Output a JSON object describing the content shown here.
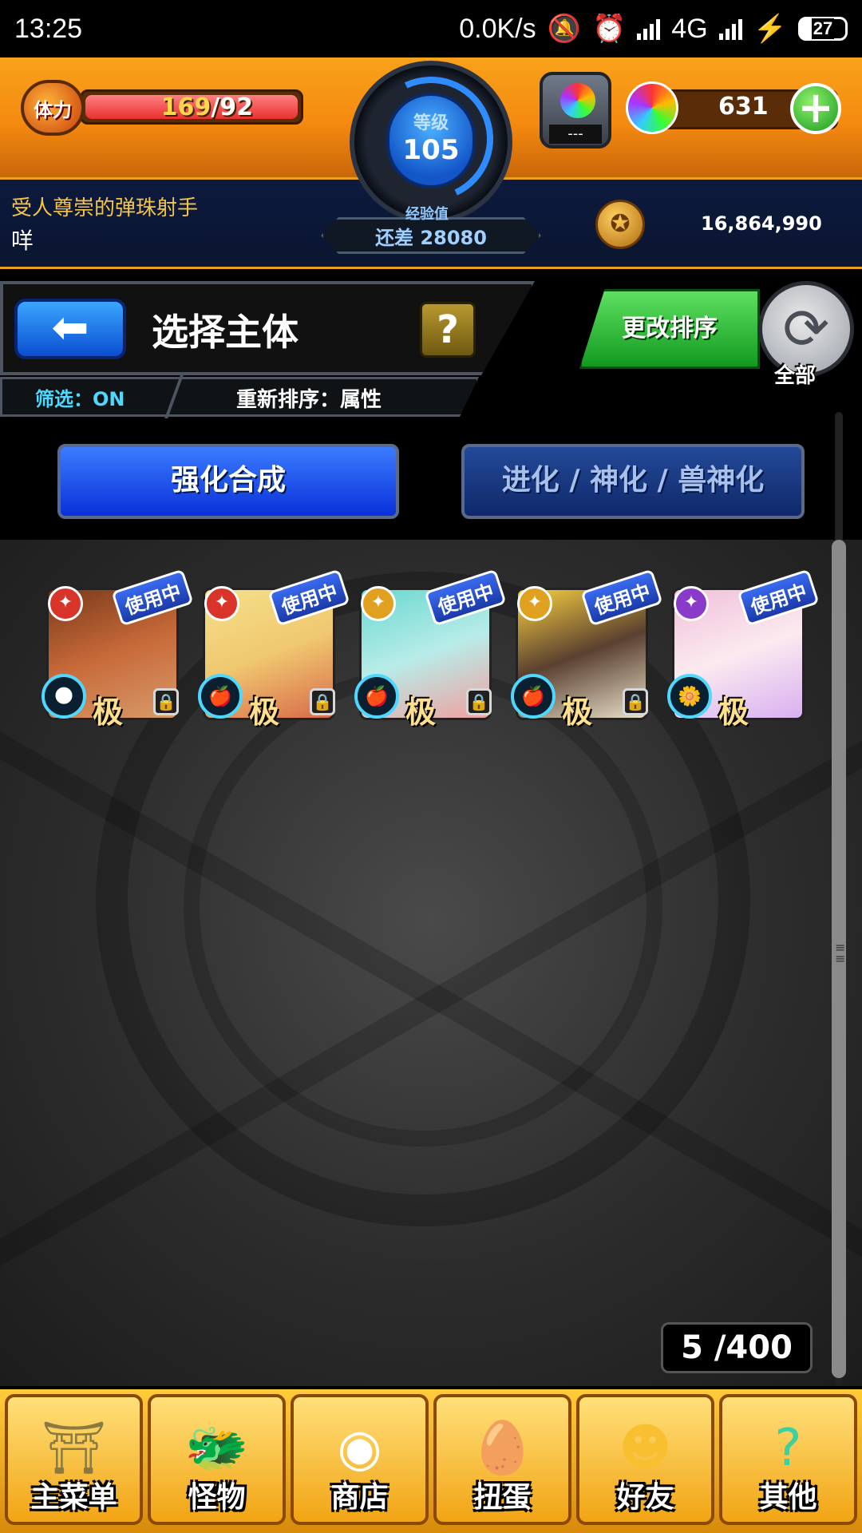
{
  "status_bar": {
    "time": "13:25",
    "net_speed": "0.0K/s",
    "network": "4G",
    "battery": "27"
  },
  "header": {
    "stamina_label": "体力",
    "stamina_current": "169",
    "stamina_max": "/92",
    "stamina_fill_fraction": 1.0,
    "level_label": "等级",
    "level_value": "105",
    "exp_label": "经验值",
    "exp_remaining": "还差 28080",
    "gem_device_text": "---",
    "orb_count": "631",
    "plus_icon": "+",
    "coin_icon": "coin-icon",
    "coins": "16,864,990",
    "player_title": "受人尊崇的弹珠射手",
    "player_name": "咩"
  },
  "toolbar": {
    "back_icon": "back-arrow-icon",
    "title": "选择主体",
    "help_label": "?",
    "filter_label": "筛选：ON",
    "sort_label": "重新排序：属性",
    "change_sort_label": "更改排序",
    "refresh_icon": "refresh-icon",
    "all_label": "全部"
  },
  "modes": {
    "enhance_label": "强化合成",
    "evolve_label": "进化 / 神化 / 兽神化"
  },
  "monsters": [
    {
      "badge": "使用中",
      "rank": "极",
      "element": "fire",
      "element_color": "#d8342a",
      "fruit": "🌑",
      "locked": true,
      "art": "linear-gradient(160deg,#7a3a1a,#c86a3a 50%,#d89a6a)"
    },
    {
      "badge": "使用中",
      "rank": "极",
      "element": "fire",
      "element_color": "#d8342a",
      "fruit": "🍎",
      "locked": true,
      "art": "linear-gradient(160deg,#f4e08a,#f0c870 50%,#d86a4a)"
    },
    {
      "badge": "使用中",
      "rank": "极",
      "element": "light",
      "element_color": "#e0a020",
      "fruit": "🍎",
      "locked": true,
      "art": "linear-gradient(160deg,#6ad8d0,#b8ece8 50%,#f0a0a0)"
    },
    {
      "badge": "使用中",
      "rank": "极",
      "element": "light",
      "element_color": "#e0a020",
      "fruit": "🍎",
      "locked": true,
      "art": "linear-gradient(160deg,#f8d040,#5a4030 50%,#e8e0c8)"
    },
    {
      "badge": "使用中",
      "rank": "极",
      "element": "dark",
      "element_color": "#8a3ac8",
      "fruit": "🌼",
      "locked": false,
      "art": "linear-gradient(160deg,#f0c0d8,#fbeaf0 50%,#d8b0f0)"
    }
  ],
  "box_count": "5 /400",
  "bottom_nav": [
    {
      "label": "主菜单",
      "icon": "home-gate-icon",
      "glyph": "⛩",
      "color": "#8a7a40"
    },
    {
      "label": "怪物",
      "icon": "monster-icon",
      "glyph": "🐲",
      "color": "#e84a20"
    },
    {
      "label": "商店",
      "icon": "rainbow-orb-icon",
      "glyph": "◉",
      "color": "#ffffff"
    },
    {
      "label": "扭蛋",
      "icon": "egg-icon",
      "glyph": "🥚",
      "color": "#f8e040"
    },
    {
      "label": "好友",
      "icon": "friends-icon",
      "glyph": "☻",
      "color": "#f8c030"
    },
    {
      "label": "其他",
      "icon": "other-icon",
      "glyph": "?",
      "color": "#3ad0a0"
    }
  ]
}
